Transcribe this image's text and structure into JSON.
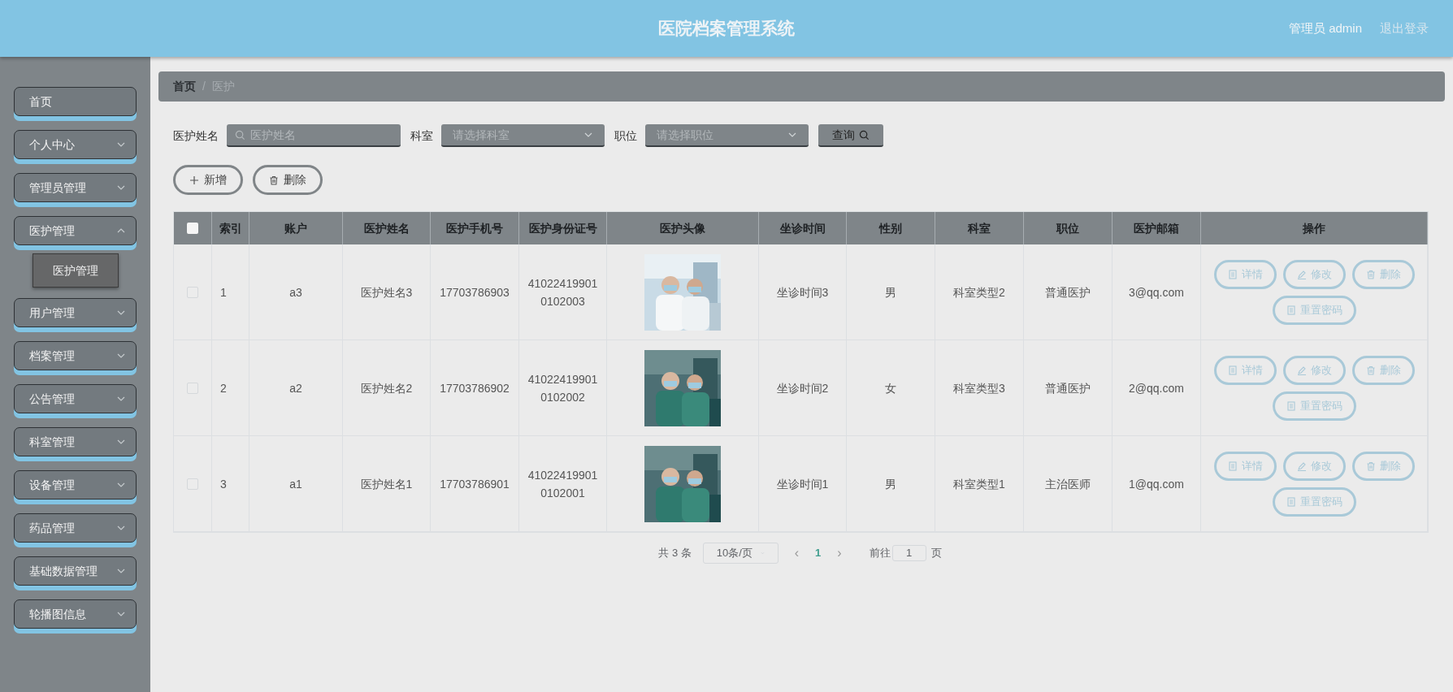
{
  "header": {
    "title": "医院档案管理系统",
    "user": "管理员 admin",
    "logout": "退出登录"
  },
  "sidebar": {
    "items": [
      {
        "label": "首页",
        "kind": "link"
      },
      {
        "label": "个人中心",
        "kind": "menu",
        "expanded": false
      },
      {
        "label": "管理员管理",
        "kind": "menu",
        "expanded": false
      },
      {
        "label": "医护管理",
        "kind": "menu",
        "expanded": true,
        "children": [
          {
            "label": "医护管理"
          }
        ]
      },
      {
        "label": "用户管理",
        "kind": "menu",
        "expanded": false
      },
      {
        "label": "档案管理",
        "kind": "menu",
        "expanded": false
      },
      {
        "label": "公告管理",
        "kind": "menu",
        "expanded": false
      },
      {
        "label": "科室管理",
        "kind": "menu",
        "expanded": false
      },
      {
        "label": "设备管理",
        "kind": "menu",
        "expanded": false
      },
      {
        "label": "药品管理",
        "kind": "menu",
        "expanded": false
      },
      {
        "label": "基础数据管理",
        "kind": "menu",
        "expanded": false
      },
      {
        "label": "轮播图信息",
        "kind": "menu",
        "expanded": false
      }
    ]
  },
  "breadcrumb": [
    "首页",
    "/",
    "医护"
  ],
  "search": {
    "fields": [
      {
        "label": "医护姓名",
        "kind": "text",
        "placeholder": "医护姓名"
      },
      {
        "label": "科室",
        "kind": "select",
        "placeholder": "请选择科室"
      },
      {
        "label": "职位",
        "kind": "select",
        "placeholder": "请选择职位"
      }
    ],
    "button": "查询"
  },
  "actions": [
    {
      "label": "新增",
      "kind": "add"
    },
    {
      "label": "删除",
      "kind": "delete"
    }
  ],
  "table": {
    "select_all_checked": false,
    "columns": [
      "索引",
      "账户",
      "医护姓名",
      "医护手机号",
      "医护身份证号",
      "医护头像",
      "坐诊时间",
      "性别",
      "科室",
      "职位",
      "医护邮箱",
      "操作"
    ],
    "rows": [
      {
        "checked": false,
        "cells": [
          "1",
          "a3",
          "医护姓名3",
          "17703786903",
          "41022419901\n0102003",
          {
            "kind": "picture"
          },
          "坐诊时间3",
          "男",
          "科室类型2",
          "普通医护",
          "3@qq.com"
        ],
        "actions": [
          {
            "label": "详情",
            "kind": "detail"
          },
          {
            "label": "修改",
            "kind": "edit"
          },
          {
            "label": "删除",
            "kind": "delete"
          },
          {
            "label": "重置密码",
            "kind": "detail"
          }
        ]
      },
      {
        "checked": false,
        "cells": [
          "2",
          "a2",
          "医护姓名2",
          "17703786902",
          "41022419901\n0102002",
          {
            "kind": "picture"
          },
          "坐诊时间2",
          "女",
          "科室类型3",
          "普通医护",
          "2@qq.com"
        ],
        "actions": [
          {
            "label": "详情",
            "kind": "detail"
          },
          {
            "label": "修改",
            "kind": "edit"
          },
          {
            "label": "删除",
            "kind": "delete"
          },
          {
            "label": "重置密码",
            "kind": "detail"
          }
        ]
      },
      {
        "checked": false,
        "cells": [
          "3",
          "a1",
          "医护姓名1",
          "17703786901",
          "41022419901\n0102001",
          {
            "kind": "picture"
          },
          "坐诊时间1",
          "男",
          "科室类型1",
          "主治医师",
          "1@qq.com"
        ],
        "actions": [
          {
            "label": "详情",
            "kind": "detail"
          },
          {
            "label": "修改",
            "kind": "edit"
          },
          {
            "label": "删除",
            "kind": "delete"
          },
          {
            "label": "重置密码",
            "kind": "detail"
          }
        ]
      }
    ]
  },
  "pagination": {
    "total": "共 3 条",
    "page_size": "10条/页",
    "prev": "‹",
    "pages": [
      {
        "label": "1",
        "selected": true
      }
    ],
    "next": "›",
    "goto_label": "前往",
    "goto_value": "1",
    "goto_suffix": "页"
  }
}
